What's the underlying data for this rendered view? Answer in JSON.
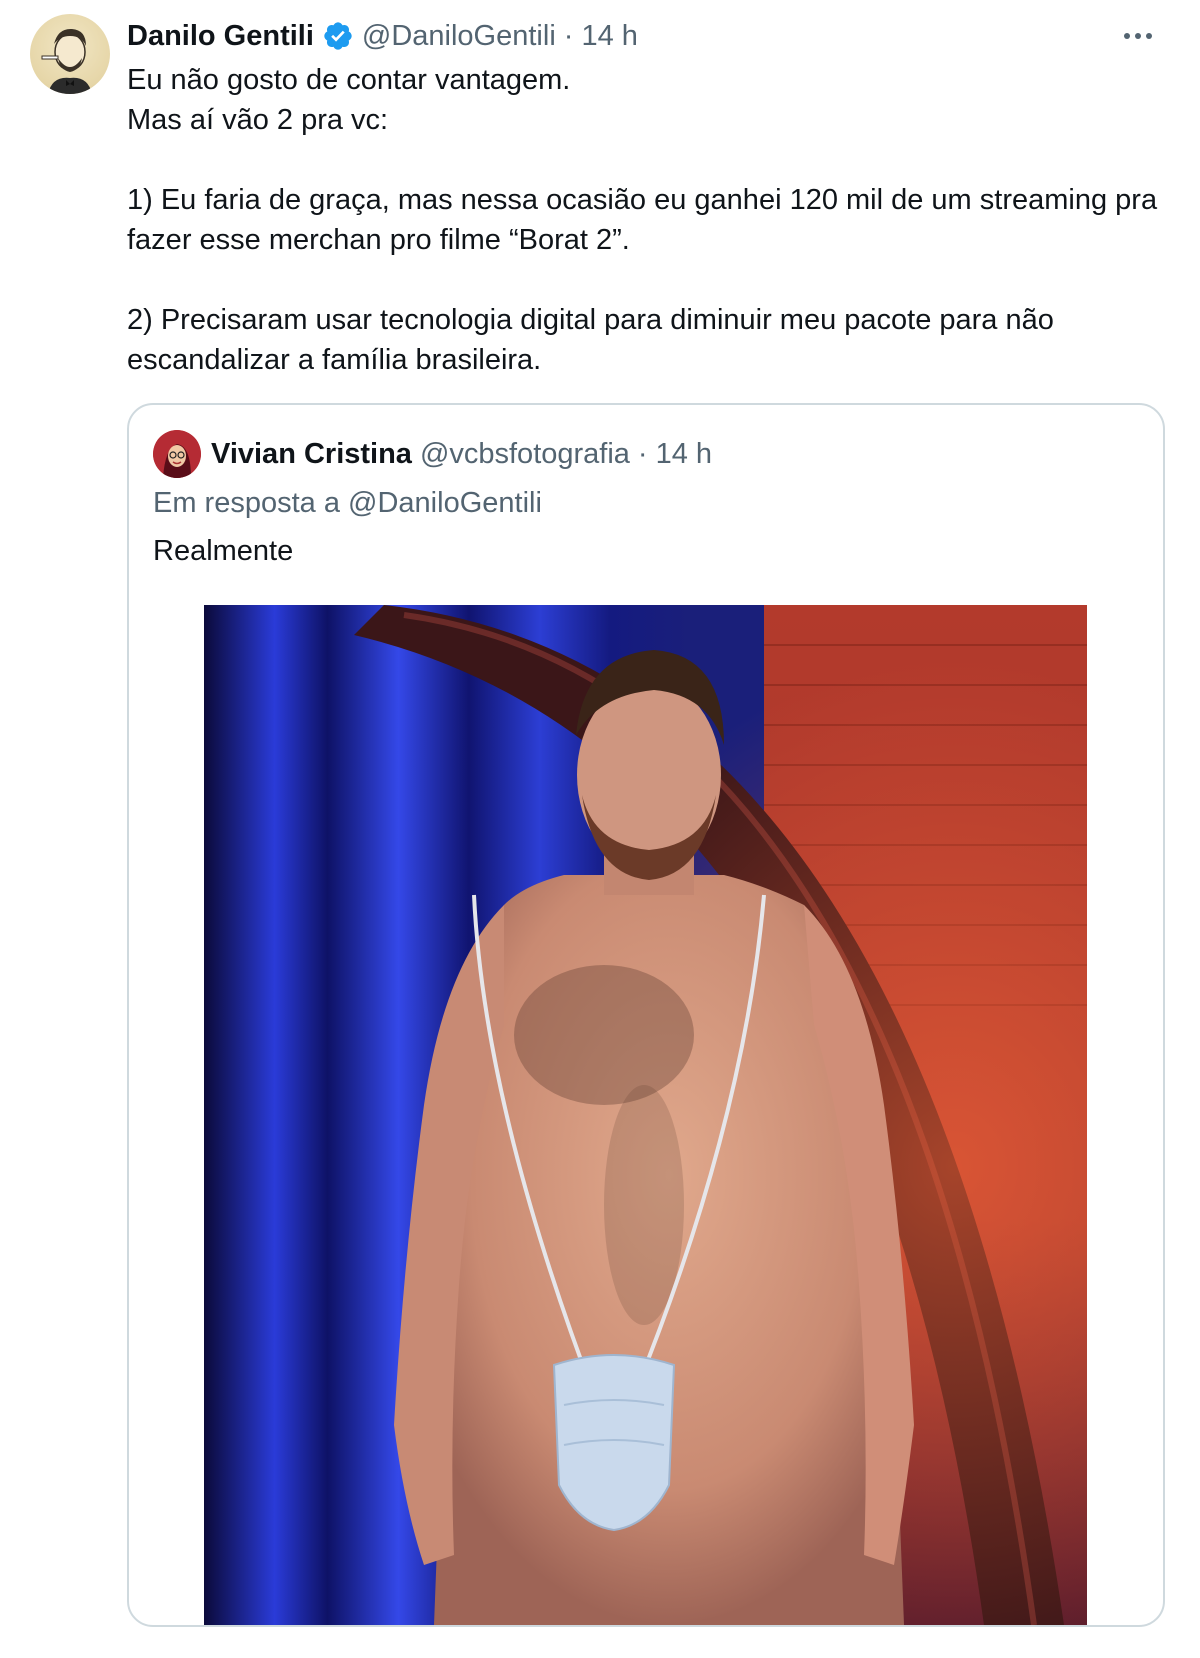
{
  "tweet": {
    "author_name": "Danilo Gentili",
    "verified": true,
    "handle": "@DaniloGentili",
    "separator": "·",
    "time": "14 h",
    "more_icon": "more-horizontal-icon",
    "lines": [
      "Eu não gosto de contar vantagem.",
      "Mas aí vão 2 pra vc:",
      "1) Eu faria de graça, mas nessa ocasião eu ganhei 120 mil de um streaming pra fazer esse merchan pro filme “Borat 2”.",
      "2) Precisaram usar tecnologia digital para diminuir meu pacote para não escandalizar a família brasileira."
    ]
  },
  "quote": {
    "author_name": "Vivian Cristina",
    "handle": "@vcbsfotografia",
    "separator": "·",
    "time": "14 h",
    "reply_prefix": "Em resposta a",
    "reply_mention": "@DaniloGentili",
    "text": "Realmente",
    "photo": "photo of a shirtless man on a stage wearing a face mask as a mankini"
  },
  "colors": {
    "text": "#0f1419",
    "secondary": "#536471",
    "verified": "#1d9bf0",
    "border": "#cfd9de"
  }
}
